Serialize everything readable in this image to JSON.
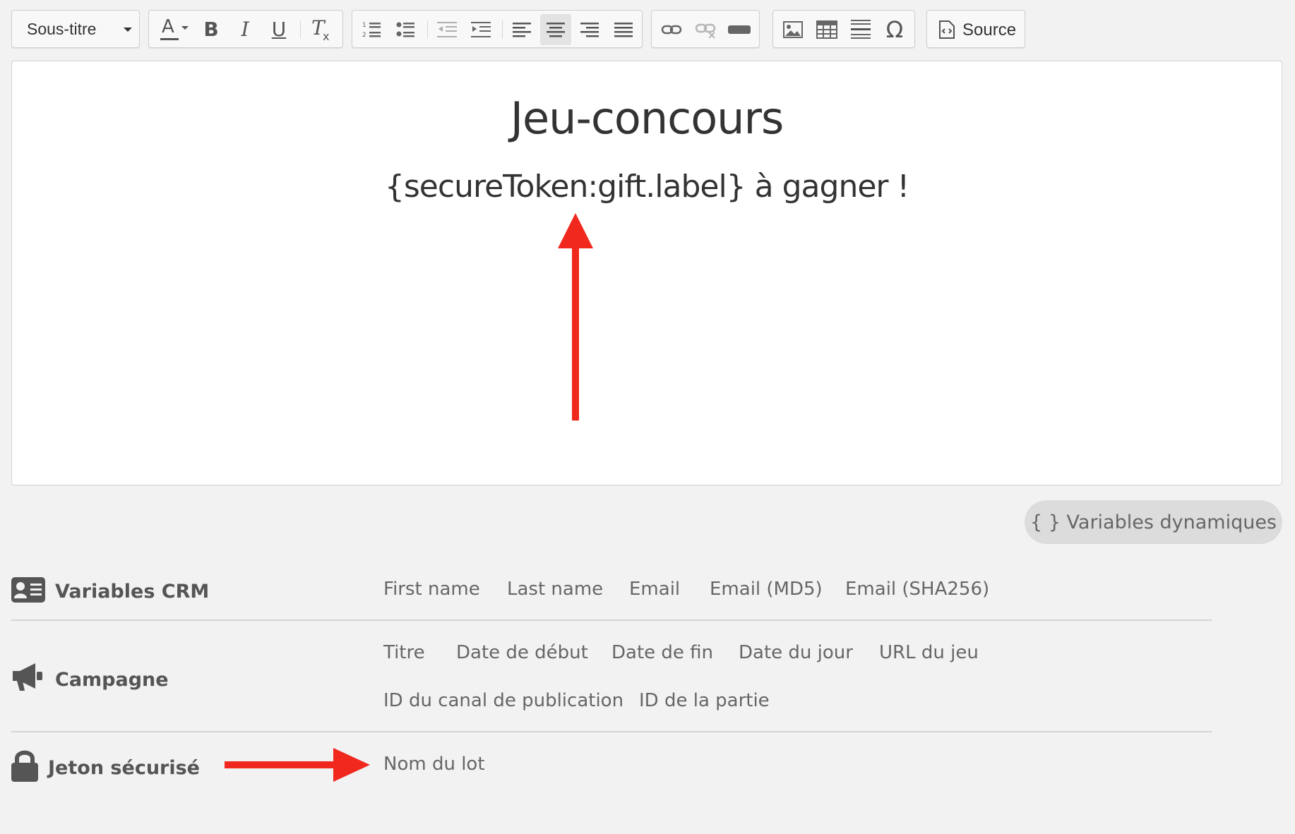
{
  "toolbar": {
    "format_dropdown": "Sous-titre",
    "source_label": "Source",
    "icons": [
      "text-color-icon",
      "bold-icon",
      "italic-icon",
      "underline-icon",
      "remove-format-icon",
      "numbered-list-icon",
      "bulleted-list-icon",
      "outdent-icon",
      "indent-icon",
      "align-left-icon",
      "align-center-icon",
      "align-right-icon",
      "justify-icon",
      "link-icon",
      "unlink-icon",
      "anchor-icon",
      "image-icon",
      "table-icon",
      "horizontal-rule-icon",
      "special-char-icon",
      "source-icon"
    ],
    "glyphs": {
      "bold": "B",
      "italic": "I",
      "underline": "U",
      "remove_format": "T",
      "omega": "Ω",
      "text_color": "A"
    }
  },
  "editor": {
    "title": "Jeu-concours",
    "subtitle": "{secureToken:gift.label} à gagner !"
  },
  "dynamic_variables_button": "{ } Variables dynamiques",
  "variables": {
    "crm": {
      "label": "Variables CRM",
      "items": [
        "First name",
        "Last name",
        "Email",
        "Email (MD5)",
        "Email (SHA256)"
      ]
    },
    "campagne": {
      "label": "Campagne",
      "items": [
        "Titre",
        "Date de début",
        "Date de fin",
        "Date du jour",
        "URL du jeu",
        "ID du canal de publication",
        "ID de la partie"
      ]
    },
    "jeton": {
      "label": "Jeton sécurisé",
      "items": [
        "Nom du lot"
      ]
    }
  },
  "colors": {
    "annotation_arrow": "#f0281e",
    "accent_active": "#e3e3e3"
  }
}
